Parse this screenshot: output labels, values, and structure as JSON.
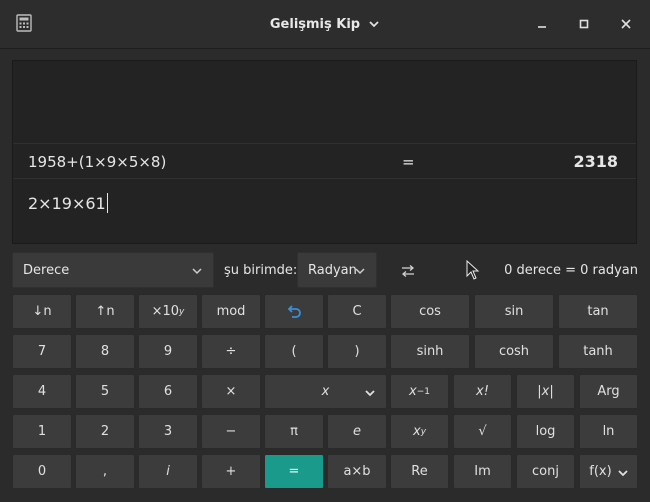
{
  "window": {
    "title": "Gelişmiş Kip",
    "accent_color": "#1a9a8a"
  },
  "display": {
    "history_expression": "1958+(1×9×5×8)",
    "history_equals": "=",
    "history_result": "2318",
    "input_expression": "2×19×61"
  },
  "conversion": {
    "from_unit": "Derece",
    "to_label": "şu birimde:",
    "to_unit": "Radyan",
    "result": "0 derece  =  0 radyan"
  },
  "keys": {
    "r1": [
      "↓n",
      "↑n",
      "×10",
      "mod",
      "undo",
      "C",
      "cos",
      "sin",
      "tan"
    ],
    "r1_x10_sup": "y",
    "r2": [
      "7",
      "8",
      "9",
      "÷",
      "(",
      ")",
      "sinh",
      "cosh",
      "tanh"
    ],
    "r3": [
      "4",
      "5",
      "6",
      "×",
      "x",
      "x",
      "x!",
      "|x|",
      "Arg"
    ],
    "r3_inv_sup": "−1",
    "r4": [
      "1",
      "2",
      "3",
      "−",
      "π",
      "e",
      "x",
      "√",
      "log",
      "ln"
    ],
    "r4_pow_sup": "y",
    "r5": [
      "0",
      ",",
      "i",
      "+",
      "=",
      "a×b",
      "Re",
      "Im",
      "conj",
      "f(x)"
    ]
  }
}
